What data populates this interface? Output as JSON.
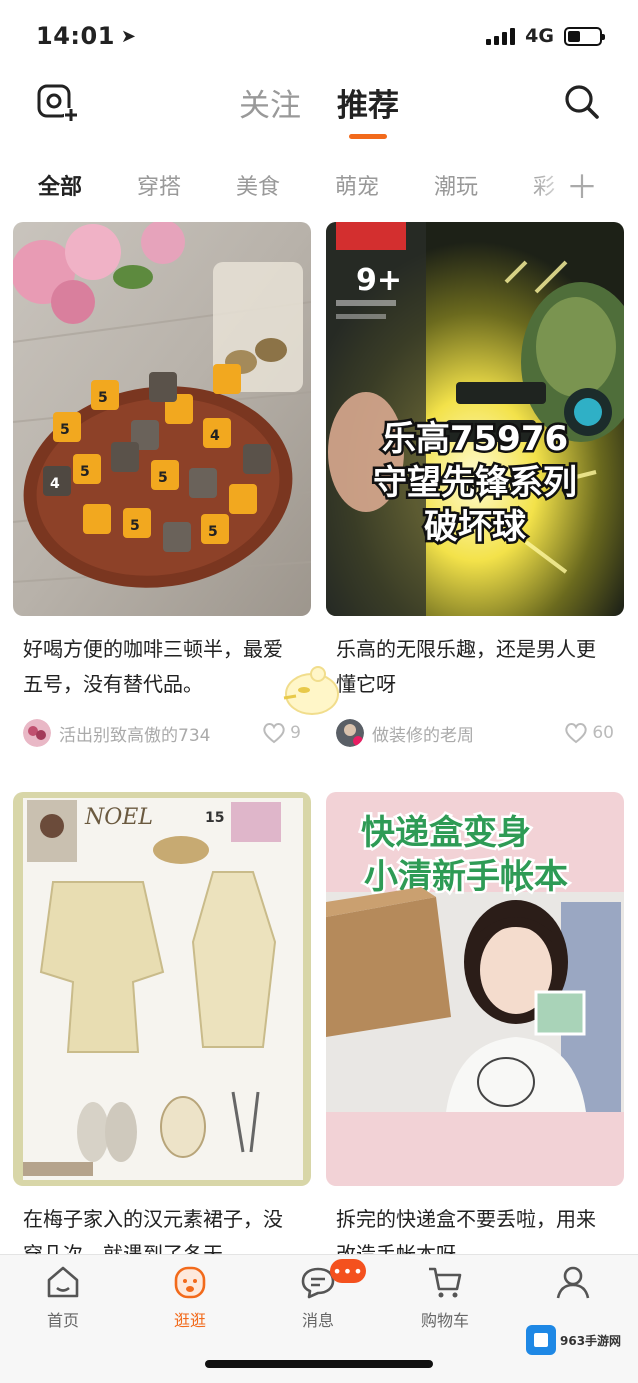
{
  "status_bar": {
    "time": "14:01",
    "network": "4G"
  },
  "top_nav": {
    "tabs": [
      {
        "label": "关注",
        "active": false
      },
      {
        "label": "推荐",
        "active": true
      }
    ]
  },
  "categories": [
    "全部",
    "穿搭",
    "美食",
    "萌宠",
    "潮玩",
    "彩"
  ],
  "feed": [
    {
      "title": "好喝方便的咖啡三顿半，最爱五号，没有替代品。",
      "author": "活出别致高傲的734",
      "likes": "9"
    },
    {
      "title": "乐高的无限乐趣，还是男人更懂它呀",
      "author": "做装修的老周",
      "likes": "60",
      "image_text": [
        "乐高75976",
        "守望先锋系列",
        "破坏球"
      ],
      "image_badge": "9+"
    },
    {
      "title": "在梅子家入的汉元素裙子，没穿几次，就遇到了冬天",
      "author": "",
      "likes": "",
      "image_text": [
        "NOEL",
        "15"
      ]
    },
    {
      "title": "拆完的快递盒不要丢啦，用来改造手帐本呀",
      "author": "",
      "likes": "",
      "image_text": [
        "快递盒变身",
        "小清新手帐本"
      ]
    }
  ],
  "tab_bar": {
    "items": [
      {
        "label": "首页",
        "icon": "home-icon",
        "active": false
      },
      {
        "label": "逛逛",
        "icon": "stroll-icon",
        "active": true
      },
      {
        "label": "消息",
        "icon": "message-icon",
        "active": false
      },
      {
        "label": "购物车",
        "icon": "cart-icon",
        "active": false
      },
      {
        "label": "",
        "icon": "profile-icon",
        "active": false
      }
    ],
    "message_badge": "•••"
  },
  "watermark": "963手游网",
  "accent_color": "#f26a1b"
}
